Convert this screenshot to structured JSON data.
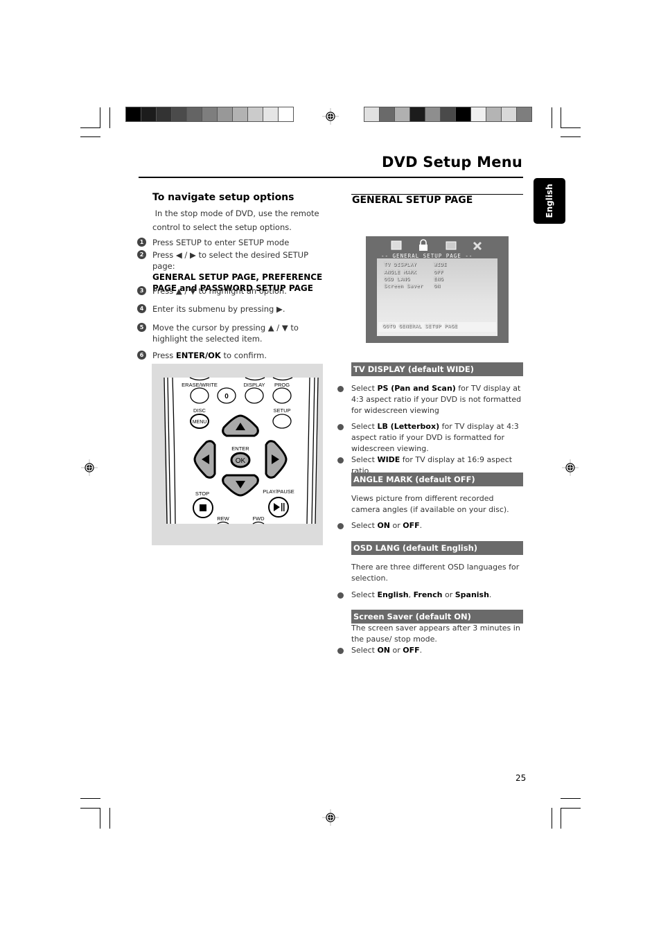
{
  "header": {
    "title": "DVD Setup Menu",
    "language_tab": "English",
    "page_number": "25"
  },
  "print_marks": {
    "left_swatches": [
      "#000000",
      "#1c1c1c",
      "#333333",
      "#4b4b4b",
      "#646464",
      "#7e7e7e",
      "#989898",
      "#b2b2b2",
      "#cbcbcb",
      "#e5e5e5",
      "#ffffff"
    ],
    "right_swatches": [
      "#e0e0e0",
      "#6a6a6a",
      "#b0b0b0",
      "#1c1c1c",
      "#8e8e8e",
      "#4a4a4a",
      "#000000",
      "#f0f0f0",
      "#b4b4b4",
      "#d8d8d8",
      "#7e7e7e"
    ]
  },
  "left": {
    "heading": "To navigate setup options",
    "intro": "In the stop mode of DVD, use the remote control to select the setup options.",
    "steps": [
      {
        "num": "1",
        "text": "Press SETUP to enter SETUP mode"
      },
      {
        "num": "2",
        "pre": "Press ◀ / ▶ to select the desired  SETUP page:",
        "bold": "GENERAL SETUP PAGE, PREFERENCE PAGE  and PASSWORD SETUP PAGE"
      },
      {
        "num": "3",
        "text": "Press  ▲ / ▼ to highlight an option."
      },
      {
        "num": "4",
        "text": "Enter its submenu by pressing  ▶."
      },
      {
        "num": "5",
        "text": "Move the cursor by pressing   ▲ / ▼  to highlight the selected item."
      },
      {
        "num": "6",
        "pre": "Press ",
        "bold": "ENTER/OK",
        "post": " to confirm."
      }
    ],
    "remote": {
      "labels": {
        "erase_write": "ERASE/WRITE",
        "display": "DISPLAY",
        "prog": "PROG",
        "zero": "0",
        "disc": "DISC",
        "menu": "MENU",
        "setup": "SETUP",
        "enter": "ENTER",
        "ok": "OK",
        "stop": "STOP",
        "play_pause": "PLAY/PAUSE",
        "rew": "REW",
        "fwd": "FWD"
      }
    }
  },
  "right": {
    "heading": "GENERAL SETUP PAGE",
    "osd": {
      "title": "-- GENERAL SETUP PAGE --",
      "rows": [
        {
          "label": "TV DISPLAY",
          "value": "WIDE"
        },
        {
          "label": "ANGLE MARK",
          "value": "OFF"
        },
        {
          "label": "OSD LANG",
          "value": "ENG"
        },
        {
          "label": "Screen Saver",
          "value": "ON"
        }
      ],
      "footer": "GOTO GENERAL SETUP PAGE"
    },
    "sections": {
      "tv_display": {
        "bar": "TV DISPLAY  (default WIDE)",
        "bullets": [
          {
            "pre": "Select ",
            "bold": "PS (Pan and Scan)",
            "post": " for TV display at 4:3 aspect ratio if your DVD is not formatted for widescreen viewing"
          },
          {
            "pre": "Select ",
            "bold": "LB (Letterbox)",
            "post": " for TV display at 4:3 aspect ratio if your DVD is formatted for widescreen viewing."
          },
          {
            "pre": "Select ",
            "bold": "WIDE",
            "post": " for TV display at 16:9 aspect ratio."
          }
        ]
      },
      "angle_mark": {
        "bar": "ANGLE MARK  (default OFF)",
        "para": "Views picture from different recorded camera angles (if available on your disc).",
        "bullet": {
          "pre": "Select ",
          "b1": "ON",
          "mid": " or ",
          "b2": "OFF",
          "post": "."
        }
      },
      "osd_lang": {
        "bar": "OSD LANG  (default English)",
        "para": "There are three different OSD languages for selection.",
        "bullet": {
          "pre": "Select ",
          "b1": "English",
          "mid1": ", ",
          "b2": "French",
          "mid2": " or ",
          "b3": "Spanish",
          "post": "."
        }
      },
      "screen_saver": {
        "bar": "Screen Saver (default ON)",
        "para": "The screen saver appears after 3 minutes in the pause/ stop mode.",
        "bullet": {
          "pre": "Select ",
          "b1": "ON",
          "mid": " or ",
          "b2": "OFF",
          "post": "."
        }
      }
    }
  }
}
